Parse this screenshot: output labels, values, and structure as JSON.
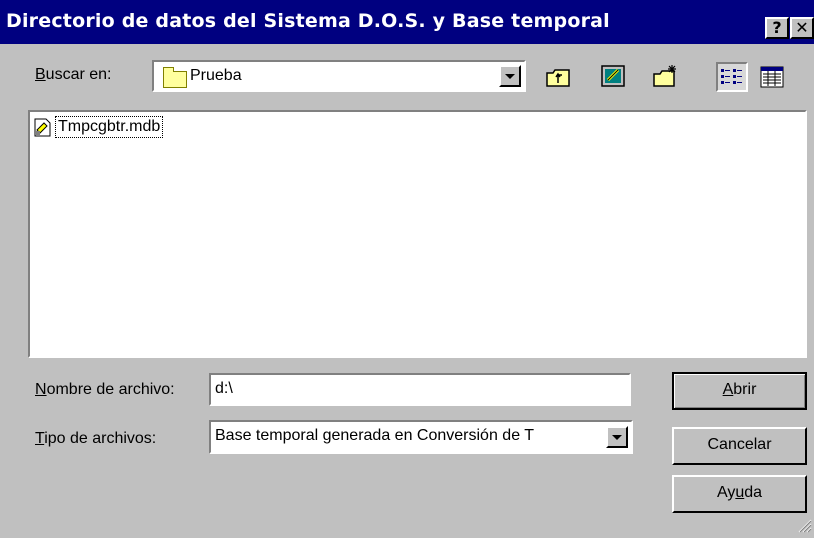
{
  "dialog": {
    "title": "Directorio de datos del Sistema D.O.S. y Base temporal",
    "help_glyph": "?",
    "close_glyph": "✕"
  },
  "lookin": {
    "label_key": "B",
    "label_rest": "uscar en:",
    "value": "Prueba",
    "icon": "folder-icon"
  },
  "toolbar": {
    "buttons": [
      "up-one-level-icon",
      "desktop-icon",
      "new-folder-icon",
      "list-view-icon",
      "details-view-icon"
    ]
  },
  "files": [
    {
      "name": "Tmpcgbtr.mdb",
      "icon": "mdb-file-icon"
    }
  ],
  "filename": {
    "label_key": "N",
    "label_rest": "ombre de archivo:",
    "value": "d:\\"
  },
  "filetype": {
    "label_key": "T",
    "label_rest": "ipo de archivos:",
    "value": "Base temporal generada en Conversión de T"
  },
  "buttons": {
    "open_key": "A",
    "open_rest": "brir",
    "cancel": "Cancelar",
    "help_pre": "Ay",
    "help_key": "u",
    "help_post": "da"
  }
}
